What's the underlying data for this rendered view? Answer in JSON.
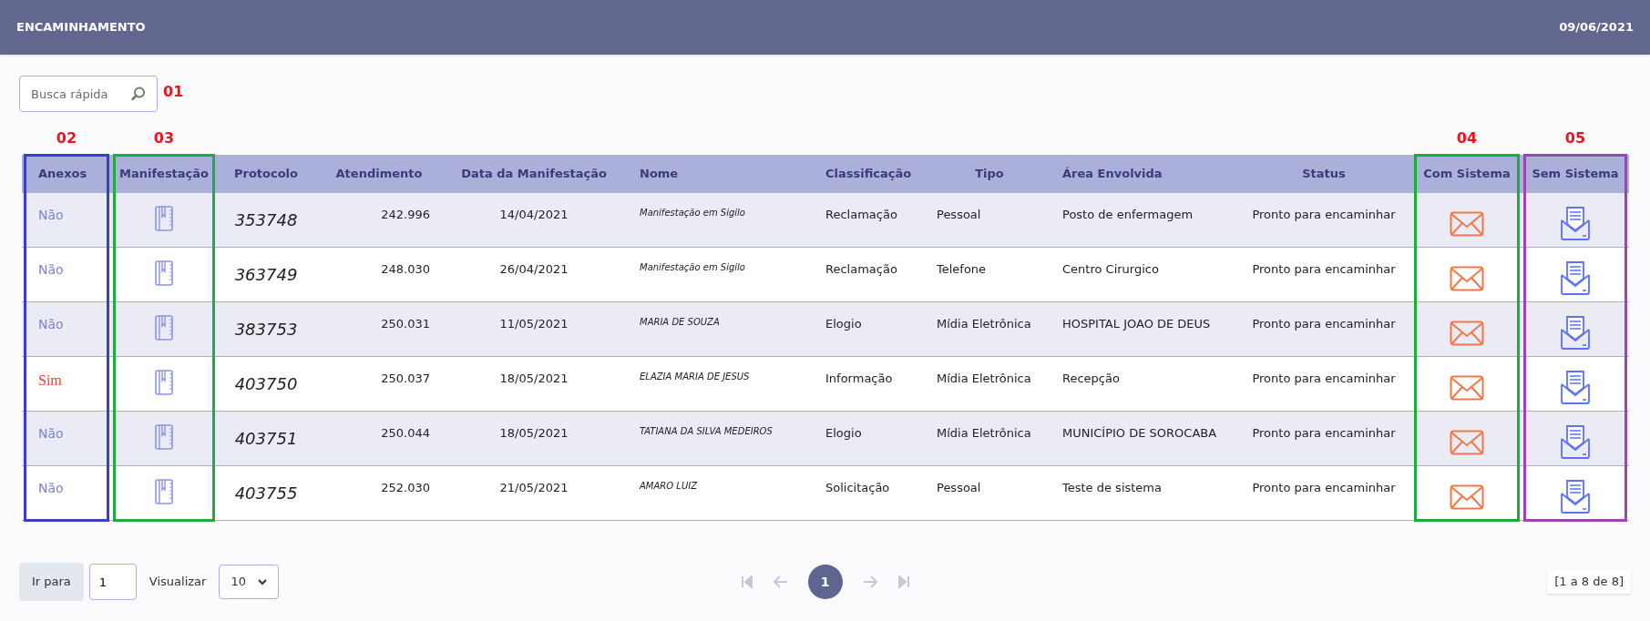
{
  "header": {
    "title": "ENCAMINHAMENTO",
    "date": "09/06/2021"
  },
  "search": {
    "placeholder": "Busca rápida",
    "marker": "01"
  },
  "table": {
    "columns": [
      {
        "label": "Anexos",
        "marker": {
          "label": "02",
          "color": "#3a3fc7"
        }
      },
      {
        "label": "Manifestação",
        "marker": {
          "label": "03",
          "color": "#22aa44"
        }
      },
      {
        "label": "Protocolo"
      },
      {
        "label": "Atendimento"
      },
      {
        "label": "Data da Manifestação"
      },
      {
        "label": "Nome"
      },
      {
        "label": "Classificação"
      },
      {
        "label": "Tipo"
      },
      {
        "label": "Área Envolvida"
      },
      {
        "label": "Status"
      },
      {
        "label": "Com Sistema",
        "marker": {
          "label": "04",
          "color": "#1fab3c"
        }
      },
      {
        "label": "Sem Sistema",
        "marker": {
          "label": "05",
          "color": "#9b45b0"
        }
      }
    ],
    "rows": [
      {
        "anexos": "Não",
        "has_attachments": false,
        "protocolo": "353748",
        "atendimento": "242.996",
        "data": "14/04/2021",
        "nome": "Manifestação em Sigilo",
        "classificacao": "Reclamação",
        "tipo": "Pessoal",
        "area": "Posto de enfermagem",
        "status": "Pronto para encaminhar"
      },
      {
        "anexos": "Não",
        "has_attachments": false,
        "protocolo": "363749",
        "atendimento": "248.030",
        "data": "26/04/2021",
        "nome": "Manifestação em Sigilo",
        "classificacao": "Reclamação",
        "tipo": "Telefone",
        "area": "Centro Cirurgico",
        "status": "Pronto para encaminhar"
      },
      {
        "anexos": "Não",
        "has_attachments": false,
        "protocolo": "383753",
        "atendimento": "250.031",
        "data": "11/05/2021",
        "nome": "MARIA DE SOUZA",
        "classificacao": "Elogio",
        "tipo": "Mídia Eletrônica",
        "area": "HOSPITAL JOAO DE DEUS",
        "status": "Pronto para encaminhar"
      },
      {
        "anexos": "Sim",
        "has_attachments": true,
        "protocolo": "403750",
        "atendimento": "250.037",
        "data": "18/05/2021",
        "nome": "ELAZIA MARIA DE JESUS",
        "classificacao": "Informação",
        "tipo": "Mídia Eletrônica",
        "area": "Recepção",
        "status": "Pronto para encaminhar"
      },
      {
        "anexos": "Não",
        "has_attachments": false,
        "protocolo": "403751",
        "atendimento": "250.044",
        "data": "18/05/2021",
        "nome": "TATIANA DA SILVA MEDEIROS",
        "classificacao": "Elogio",
        "tipo": "Mídia Eletrônica",
        "area": "MUNICÍPIO DE SOROCABA",
        "status": "Pronto para encaminhar"
      },
      {
        "anexos": "Não",
        "has_attachments": false,
        "protocolo": "403755",
        "atendimento": "252.030",
        "data": "21/05/2021",
        "nome": "AMARO LUIZ",
        "classificacao": "Solicitação",
        "tipo": "Pessoal",
        "area": "Teste de sistema",
        "status": "Pronto para encaminhar"
      }
    ]
  },
  "footer": {
    "goto_label": "Ir para",
    "goto_value": "1",
    "view_label": "Visualizar",
    "page_size": "10",
    "current_page": "1",
    "range": "[1 a 8 de 8]"
  }
}
